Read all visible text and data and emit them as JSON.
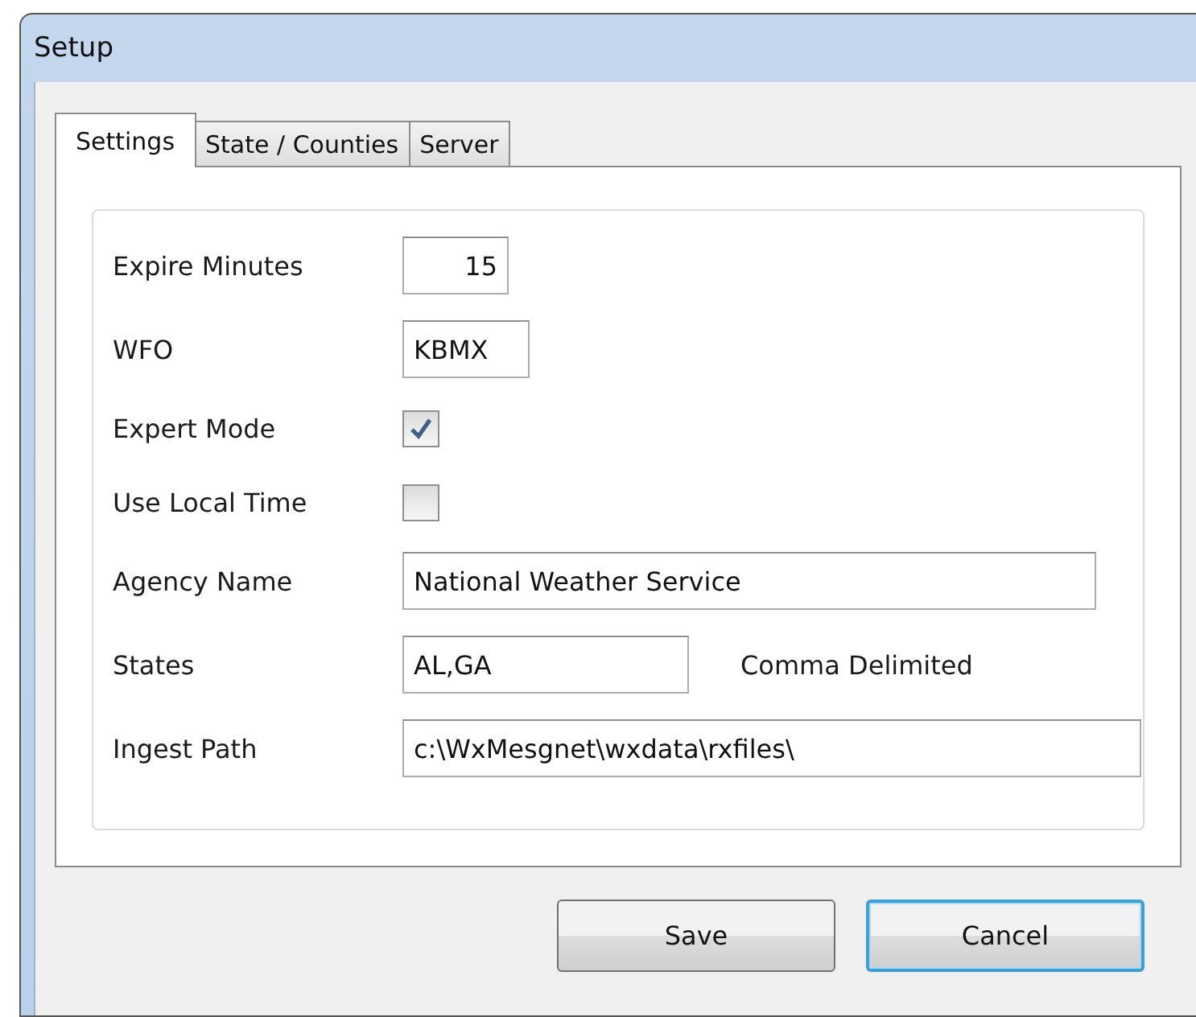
{
  "window": {
    "title": "Setup"
  },
  "tabs": [
    {
      "label": "Settings",
      "selected": true
    },
    {
      "label": "State / Counties",
      "selected": false
    },
    {
      "label": "Server",
      "selected": false
    }
  ],
  "fields": [
    {
      "kind": "text",
      "label": "Expire Minutes",
      "value": "15"
    },
    {
      "kind": "text",
      "label": "WFO",
      "value": "KBMX"
    },
    {
      "kind": "checkbox",
      "label": "Expert Mode",
      "checked": true
    },
    {
      "kind": "checkbox",
      "label": "Use Local Time",
      "checked": false
    },
    {
      "kind": "text",
      "label": "Agency Name",
      "value": "National Weather Service"
    },
    {
      "kind": "text",
      "label": "States",
      "value": "AL,GA",
      "note": "Comma Delimited"
    },
    {
      "kind": "text",
      "label": "Ingest Path",
      "value": "c:\\WxMesgnet\\wxdata\\rxfiles\\"
    }
  ],
  "buttons": [
    {
      "label": "Save",
      "focused": false
    },
    {
      "label": "Cancel",
      "focused": true
    }
  ]
}
